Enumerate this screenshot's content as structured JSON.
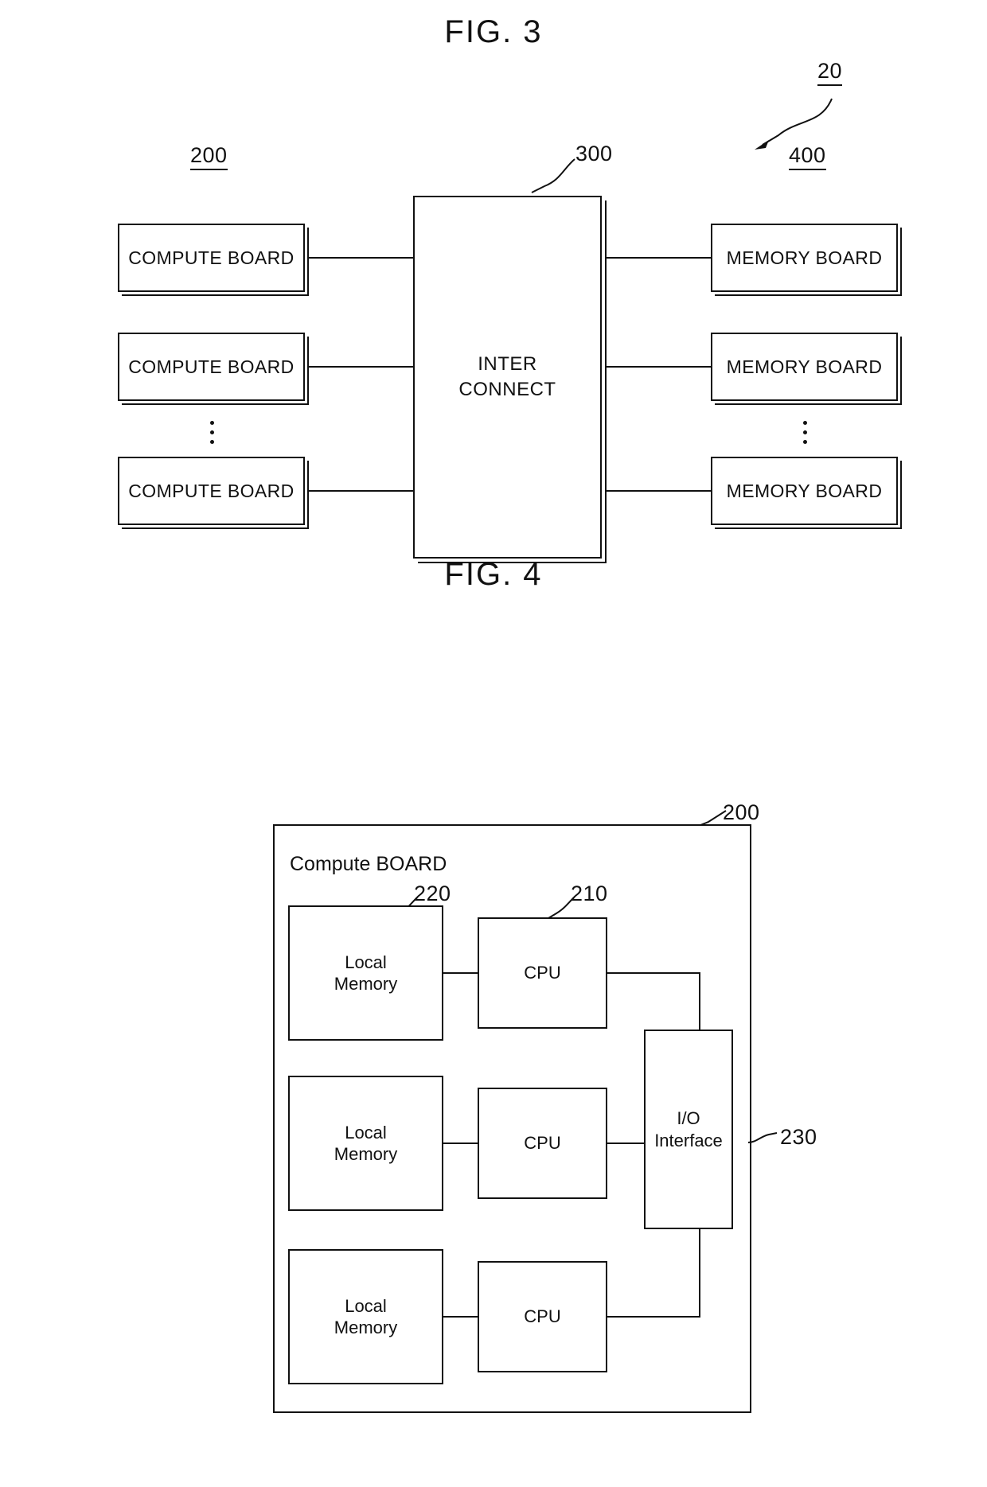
{
  "figures": [
    {
      "id": "fig3",
      "title": "FIG. 3",
      "system_ref": "20",
      "refs": {
        "compute_group": "200",
        "interconnect": "300",
        "memory_group": "400"
      },
      "compute_boards": [
        {
          "label": "COMPUTE BOARD"
        },
        {
          "label": "COMPUTE BOARD"
        },
        {
          "label": "COMPUTE BOARD"
        }
      ],
      "interconnect": {
        "line1": "INTER",
        "line2": "CONNECT"
      },
      "memory_boards": [
        {
          "label": "MEMORY BOARD"
        },
        {
          "label": "MEMORY BOARD"
        },
        {
          "label": "MEMORY BOARD"
        }
      ],
      "ellipsis": "vertical-dots"
    },
    {
      "id": "fig4",
      "title": "FIG. 4",
      "board_caption": "Compute BOARD",
      "refs": {
        "board": "200",
        "local_memory": "220",
        "cpu": "210",
        "io_interface": "230"
      },
      "rows": [
        {
          "memory_line1": "Local",
          "memory_line2": "Memory",
          "cpu": "CPU"
        },
        {
          "memory_line1": "Local",
          "memory_line2": "Memory",
          "cpu": "CPU"
        },
        {
          "memory_line1": "Local",
          "memory_line2": "Memory",
          "cpu": "CPU"
        }
      ],
      "io_interface": {
        "line1": "I/O",
        "line2": "Interface"
      }
    }
  ],
  "colors": {
    "ink": "#111111",
    "paper": "#ffffff"
  }
}
